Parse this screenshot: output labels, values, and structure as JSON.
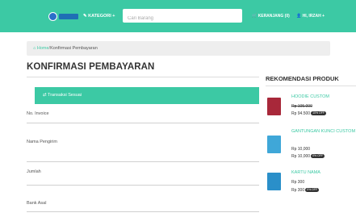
{
  "header": {
    "logo_alt": "logo",
    "category_label": "KATEGORI +",
    "search_placeholder": "Cari Barang",
    "cart_label": "KERANJANG (0)",
    "user_label": "HI, IRZAH +"
  },
  "breadcrumb": {
    "home": "Home",
    "separator": "/",
    "current": "Konfirmasi Pembayaran"
  },
  "page": {
    "title": "KONFIRMASI PEMBAYARAN",
    "transfer_bar_label": "Transaksi Sesuai"
  },
  "form": {
    "fields": [
      {
        "label": "No. Invoice"
      },
      {
        "label": "Nama Pengirim"
      },
      {
        "label": "Jumlah"
      },
      {
        "label": "Bank Asal"
      }
    ]
  },
  "recommendations": {
    "title": "REKOMENDASI PRODUK",
    "items": [
      {
        "name": "HOODIE CUSTOM",
        "old_price": "Rp 105.000",
        "price": "Rp 94.500",
        "badge": "10% OFF",
        "image_color": "#a8283a",
        "icon": "hoodie-image"
      },
      {
        "name": "GANTUNGAN KUNCI CUSTOM",
        "old_price": "Rp 10,000",
        "price": "Rp 10,000",
        "badge": "0% OFF",
        "image_color": "#3fa7d8",
        "icon": "keychain-image"
      },
      {
        "name": "KARTU NAMA",
        "old_price": "Rp 300",
        "price": "Rp 300",
        "badge": "0% OFF",
        "image_color": "#2a8fc9",
        "icon": "business-card-image"
      }
    ]
  }
}
